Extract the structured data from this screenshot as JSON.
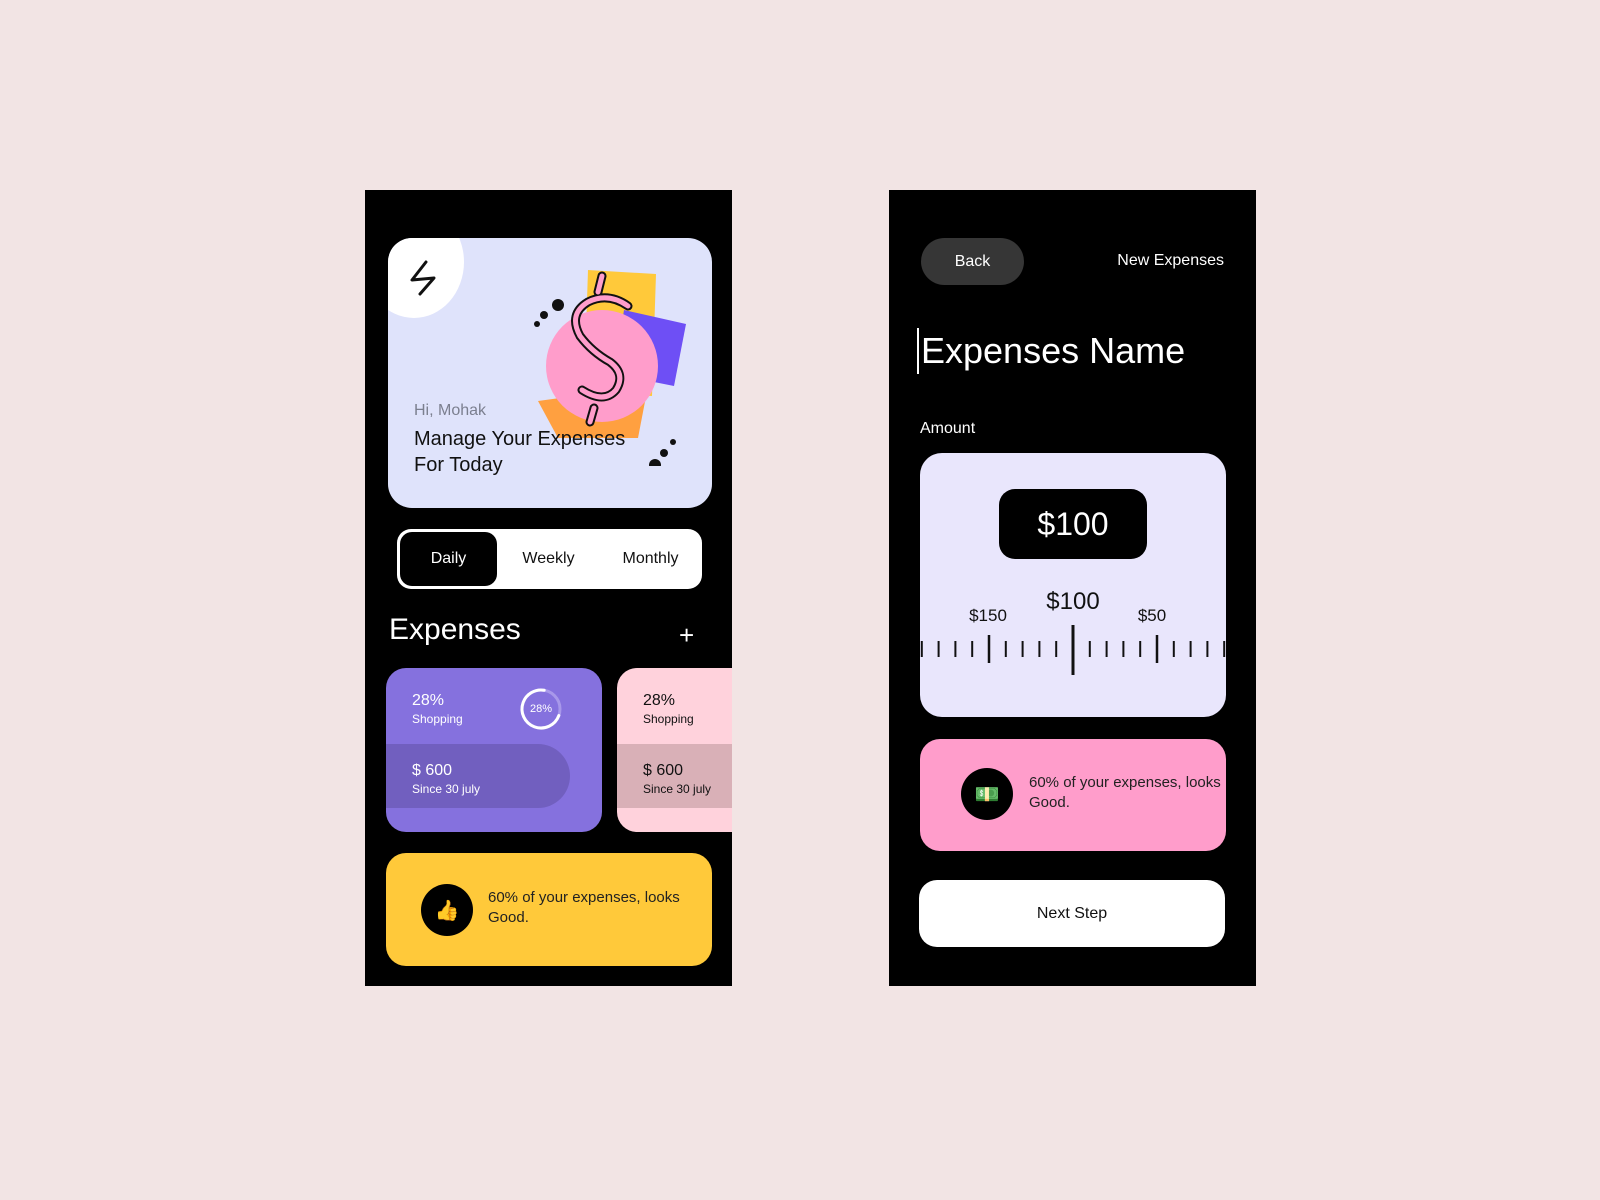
{
  "left_screen": {
    "hero": {
      "greeting": "Hi, Mohak",
      "title": "Manage Your Expenses For Today",
      "logo_icon": "lightning-bolt-icon",
      "illustration": "dollar-sign-illustration"
    },
    "period_tabs": [
      {
        "label": "Daily",
        "active": true
      },
      {
        "label": "Weekly",
        "active": false
      },
      {
        "label": "Monthly",
        "active": false
      }
    ],
    "expenses": {
      "heading": "Expenses",
      "add_icon": "plus-icon",
      "cards": [
        {
          "percent": "28%",
          "category": "Shopping",
          "amount": "$ 600",
          "since": "Since 30 july",
          "ring_label": "28%",
          "ring_progress": 0.72,
          "color": "#8571de"
        },
        {
          "percent": "28%",
          "category": "Shopping",
          "amount": "$ 600",
          "since": "Since 30 july",
          "color": "#ffd2dc"
        }
      ]
    },
    "tip": {
      "icon": "thumbs-up-icon",
      "emoji": "👍",
      "text": "60% of your expenses, looks Good.",
      "color": "#ffc93a"
    }
  },
  "right_screen": {
    "back_label": "Back",
    "title": "New Expenses",
    "name_field": {
      "placeholder": "Expenses Name"
    },
    "amount_label": "Amount",
    "amount_value": "$100",
    "ruler": {
      "selected_label": "$100",
      "left_label": "$150",
      "right_label": "$50",
      "selected": 100,
      "min": 0,
      "max": 200
    },
    "tip": {
      "icon": "money-bill-icon",
      "emoji": "💵",
      "text": "60% of your expenses, looks Good.",
      "color": "#ff9dcb"
    },
    "next_label": "Next Step"
  }
}
